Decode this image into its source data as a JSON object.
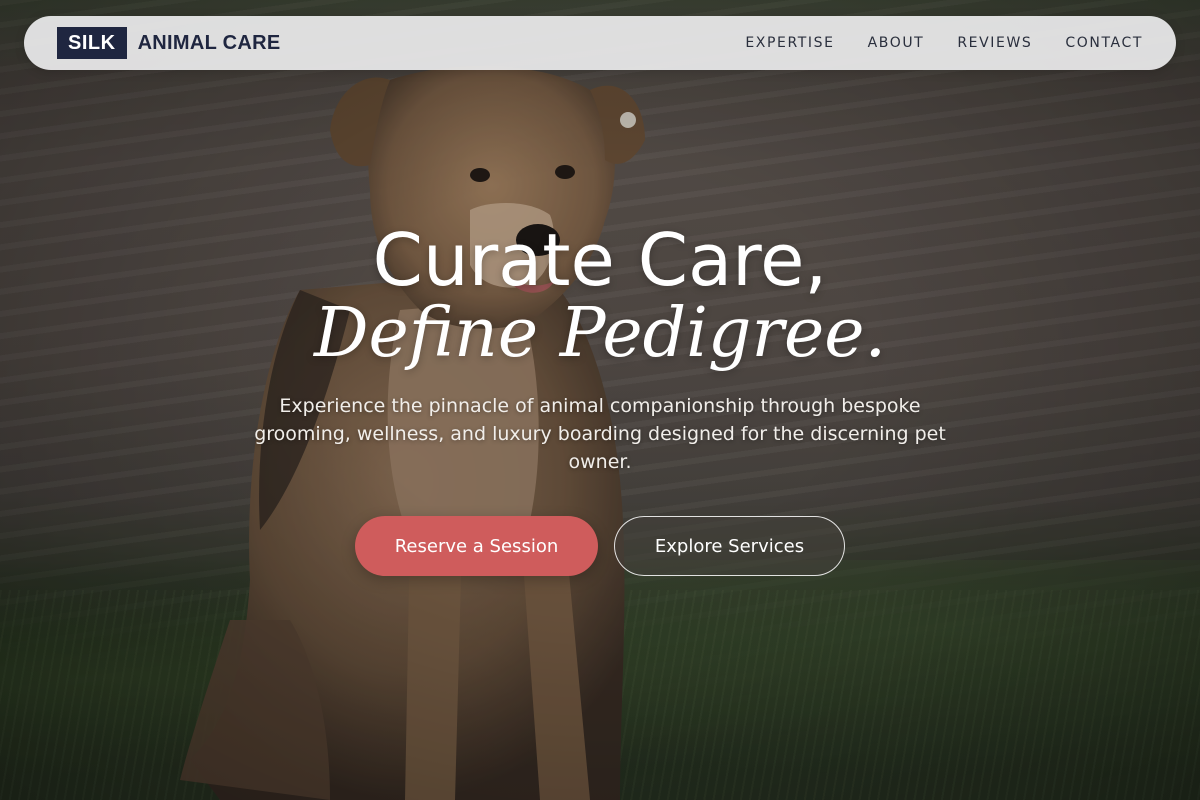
{
  "brand": {
    "box_text": "SILK",
    "name": "ANIMAL CARE"
  },
  "nav": {
    "links": [
      "EXPERTISE",
      "ABOUT",
      "REVIEWS",
      "CONTACT"
    ]
  },
  "hero": {
    "headline": "Curate Care,",
    "headline_italic": "Define Pedigree.",
    "subtext": "Experience the pinnacle of animal companionship through bespoke grooming, wellness, and luxury boarding designed for the discerning pet owner.",
    "primary_button": "Reserve a Session",
    "secondary_button": "Explore Services"
  },
  "colors": {
    "brand_navy": "#1f2640",
    "primary_button": "#cf5c5c",
    "nav_background": "#ebebec"
  }
}
